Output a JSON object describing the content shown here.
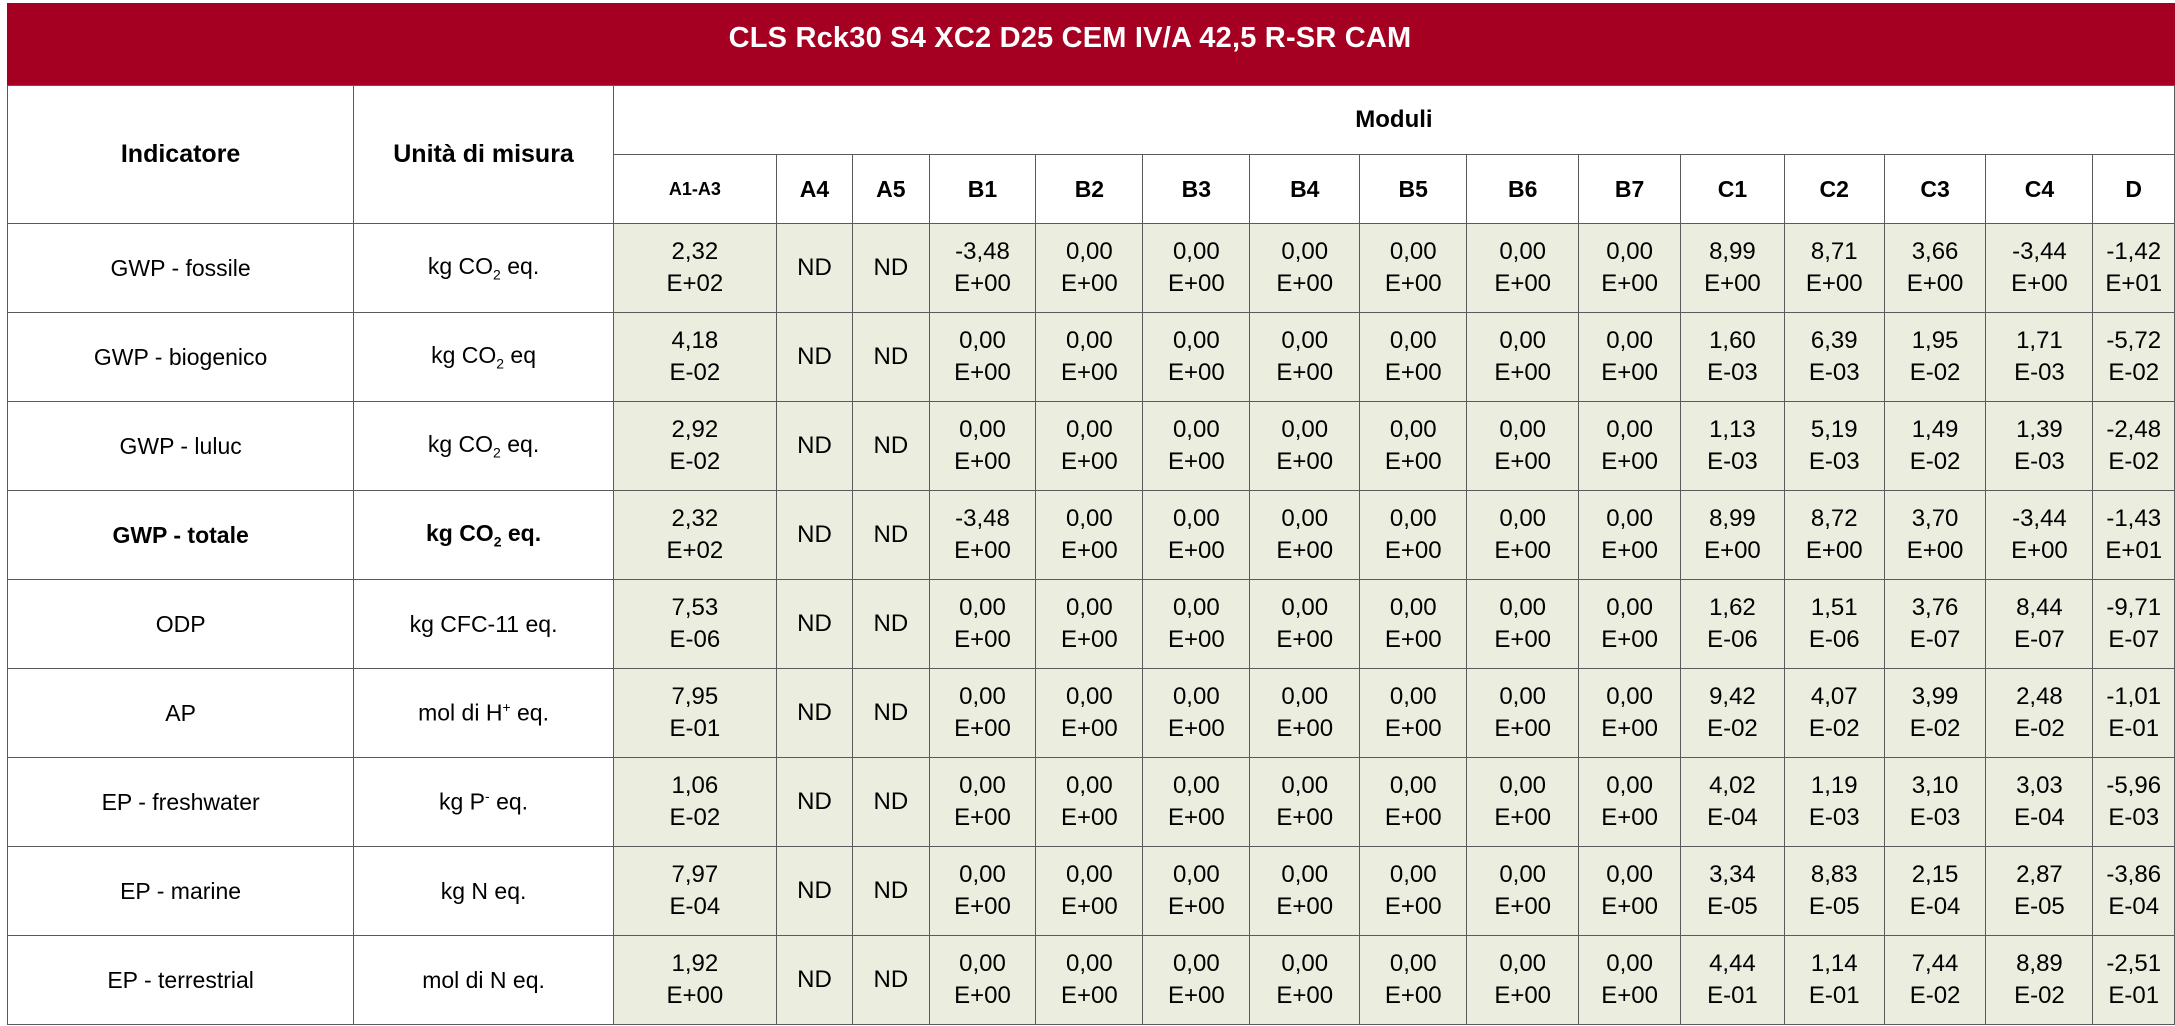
{
  "title": "CLS Rck30 S4 XC2 D25 CEM IV/A 42,5 R-SR CAM",
  "headers": {
    "indicator": "Indicatore",
    "unit": "Unità di misura",
    "moduli": "Moduli",
    "modules": [
      "A1-A3",
      "A4",
      "A5",
      "B1",
      "B2",
      "B3",
      "B4",
      "B5",
      "B6",
      "B7",
      "C1",
      "C2",
      "C3",
      "C4",
      "D"
    ]
  },
  "colors": {
    "title_bg": "#a50021",
    "value_bg": "#ebeedf"
  },
  "rows": [
    {
      "indicator": "GWP - fossile",
      "unit_pre": "kg CO",
      "unit_sub": "2",
      "unit_post": " eq.",
      "bold": false,
      "values": [
        [
          "2,32",
          "E+02"
        ],
        [
          "ND",
          ""
        ],
        [
          "ND",
          ""
        ],
        [
          "-3,48",
          "E+00"
        ],
        [
          "0,00",
          "E+00"
        ],
        [
          "0,00",
          "E+00"
        ],
        [
          "0,00",
          "E+00"
        ],
        [
          "0,00",
          "E+00"
        ],
        [
          "0,00",
          "E+00"
        ],
        [
          "0,00",
          "E+00"
        ],
        [
          "8,99",
          "E+00"
        ],
        [
          "8,71",
          "E+00"
        ],
        [
          "3,66",
          "E+00"
        ],
        [
          "-3,44",
          "E+00"
        ],
        [
          "-1,42",
          "E+01"
        ]
      ]
    },
    {
      "indicator": "GWP - biogenico",
      "unit_pre": "kg CO",
      "unit_sub": "2",
      "unit_post": " eq",
      "bold": false,
      "values": [
        [
          "4,18",
          "E-02"
        ],
        [
          "ND",
          ""
        ],
        [
          "ND",
          ""
        ],
        [
          "0,00",
          "E+00"
        ],
        [
          "0,00",
          "E+00"
        ],
        [
          "0,00",
          "E+00"
        ],
        [
          "0,00",
          "E+00"
        ],
        [
          "0,00",
          "E+00"
        ],
        [
          "0,00",
          "E+00"
        ],
        [
          "0,00",
          "E+00"
        ],
        [
          "1,60",
          "E-03"
        ],
        [
          "6,39",
          "E-03"
        ],
        [
          "1,95",
          "E-02"
        ],
        [
          "1,71",
          "E-03"
        ],
        [
          "-5,72",
          "E-02"
        ]
      ]
    },
    {
      "indicator": "GWP - luluc",
      "unit_pre": "kg CO",
      "unit_sub": "2",
      "unit_post": " eq.",
      "bold": false,
      "values": [
        [
          "2,92",
          "E-02"
        ],
        [
          "ND",
          ""
        ],
        [
          "ND",
          ""
        ],
        [
          "0,00",
          "E+00"
        ],
        [
          "0,00",
          "E+00"
        ],
        [
          "0,00",
          "E+00"
        ],
        [
          "0,00",
          "E+00"
        ],
        [
          "0,00",
          "E+00"
        ],
        [
          "0,00",
          "E+00"
        ],
        [
          "0,00",
          "E+00"
        ],
        [
          "1,13",
          "E-03"
        ],
        [
          "5,19",
          "E-03"
        ],
        [
          "1,49",
          "E-02"
        ],
        [
          "1,39",
          "E-03"
        ],
        [
          "-2,48",
          "E-02"
        ]
      ]
    },
    {
      "indicator": "GWP - totale",
      "unit_pre": "kg CO",
      "unit_sub": "2",
      "unit_post": " eq.",
      "bold": true,
      "values": [
        [
          "2,32",
          "E+02"
        ],
        [
          "ND",
          ""
        ],
        [
          "ND",
          ""
        ],
        [
          "-3,48",
          "E+00"
        ],
        [
          "0,00",
          "E+00"
        ],
        [
          "0,00",
          "E+00"
        ],
        [
          "0,00",
          "E+00"
        ],
        [
          "0,00",
          "E+00"
        ],
        [
          "0,00",
          "E+00"
        ],
        [
          "0,00",
          "E+00"
        ],
        [
          "8,99",
          "E+00"
        ],
        [
          "8,72",
          "E+00"
        ],
        [
          "3,70",
          "E+00"
        ],
        [
          "-3,44",
          "E+00"
        ],
        [
          "-1,43",
          "E+01"
        ]
      ]
    },
    {
      "indicator": "ODP",
      "unit_pre": "kg CFC-11 eq.",
      "unit_sub": "",
      "unit_post": "",
      "bold": false,
      "values": [
        [
          "7,53",
          "E-06"
        ],
        [
          "ND",
          ""
        ],
        [
          "ND",
          ""
        ],
        [
          "0,00",
          "E+00"
        ],
        [
          "0,00",
          "E+00"
        ],
        [
          "0,00",
          "E+00"
        ],
        [
          "0,00",
          "E+00"
        ],
        [
          "0,00",
          "E+00"
        ],
        [
          "0,00",
          "E+00"
        ],
        [
          "0,00",
          "E+00"
        ],
        [
          "1,62",
          "E-06"
        ],
        [
          "1,51",
          "E-06"
        ],
        [
          "3,76",
          "E-07"
        ],
        [
          "8,44",
          "E-07"
        ],
        [
          "-9,71",
          "E-07"
        ]
      ]
    },
    {
      "indicator": "AP",
      "unit_pre": "mol di H",
      "unit_sup": "+",
      "unit_post": " eq.",
      "bold": false,
      "values": [
        [
          "7,95",
          "E-01"
        ],
        [
          "ND",
          ""
        ],
        [
          "ND",
          ""
        ],
        [
          "0,00",
          "E+00"
        ],
        [
          "0,00",
          "E+00"
        ],
        [
          "0,00",
          "E+00"
        ],
        [
          "0,00",
          "E+00"
        ],
        [
          "0,00",
          "E+00"
        ],
        [
          "0,00",
          "E+00"
        ],
        [
          "0,00",
          "E+00"
        ],
        [
          "9,42",
          "E-02"
        ],
        [
          "4,07",
          "E-02"
        ],
        [
          "3,99",
          "E-02"
        ],
        [
          "2,48",
          "E-02"
        ],
        [
          "-1,01",
          "E-01"
        ]
      ]
    },
    {
      "indicator": "EP - freshwater",
      "unit_pre": "kg P",
      "unit_sup": "-",
      "unit_post": " eq.",
      "bold": false,
      "values": [
        [
          "1,06",
          "E-02"
        ],
        [
          "ND",
          ""
        ],
        [
          "ND",
          ""
        ],
        [
          "0,00",
          "E+00"
        ],
        [
          "0,00",
          "E+00"
        ],
        [
          "0,00",
          "E+00"
        ],
        [
          "0,00",
          "E+00"
        ],
        [
          "0,00",
          "E+00"
        ],
        [
          "0,00",
          "E+00"
        ],
        [
          "0,00",
          "E+00"
        ],
        [
          "4,02",
          "E-04"
        ],
        [
          "1,19",
          "E-03"
        ],
        [
          "3,10",
          "E-03"
        ],
        [
          "3,03",
          "E-04"
        ],
        [
          "-5,96",
          "E-03"
        ]
      ]
    },
    {
      "indicator": "EP - marine",
      "unit_pre": "kg N eq.",
      "unit_sub": "",
      "unit_post": "",
      "bold": false,
      "values": [
        [
          "7,97",
          "E-04"
        ],
        [
          "ND",
          ""
        ],
        [
          "ND",
          ""
        ],
        [
          "0,00",
          "E+00"
        ],
        [
          "0,00",
          "E+00"
        ],
        [
          "0,00",
          "E+00"
        ],
        [
          "0,00",
          "E+00"
        ],
        [
          "0,00",
          "E+00"
        ],
        [
          "0,00",
          "E+00"
        ],
        [
          "0,00",
          "E+00"
        ],
        [
          "3,34",
          "E-05"
        ],
        [
          "8,83",
          "E-05"
        ],
        [
          "2,15",
          "E-04"
        ],
        [
          "2,87",
          "E-05"
        ],
        [
          "-3,86",
          "E-04"
        ]
      ]
    },
    {
      "indicator": "EP - terrestrial",
      "unit_pre": "mol di N eq.",
      "unit_sub": "",
      "unit_post": "",
      "bold": false,
      "values": [
        [
          "1,92",
          "E+00"
        ],
        [
          "ND",
          ""
        ],
        [
          "ND",
          ""
        ],
        [
          "0,00",
          "E+00"
        ],
        [
          "0,00",
          "E+00"
        ],
        [
          "0,00",
          "E+00"
        ],
        [
          "0,00",
          "E+00"
        ],
        [
          "0,00",
          "E+00"
        ],
        [
          "0,00",
          "E+00"
        ],
        [
          "0,00",
          "E+00"
        ],
        [
          "4,44",
          "E-01"
        ],
        [
          "1,14",
          "E-01"
        ],
        [
          "7,44",
          "E-02"
        ],
        [
          "8,89",
          "E-02"
        ],
        [
          "-2,51",
          "E-01"
        ]
      ]
    }
  ]
}
